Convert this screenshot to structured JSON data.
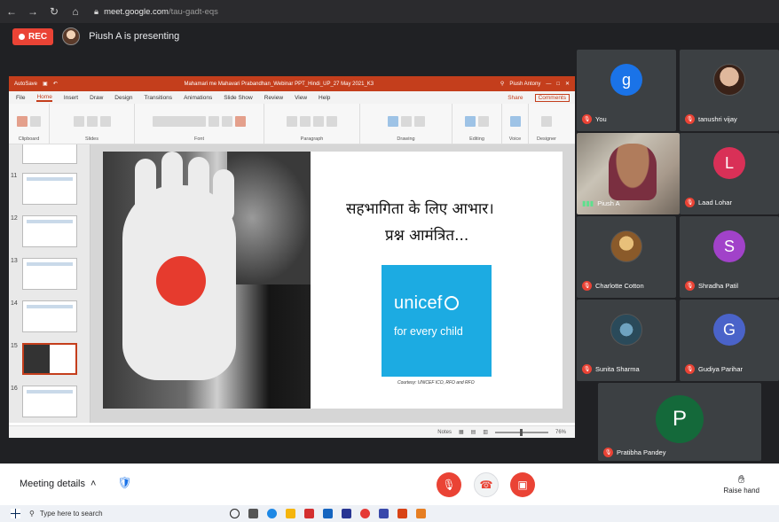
{
  "browser": {
    "url_host": "meet.google.com",
    "url_path": "/tau-gadt-eqs"
  },
  "meet": {
    "rec_label": "REC",
    "presenting_text": "Piush A is presenting",
    "meeting_details_label": "Meeting details",
    "raise_hand_label": "Raise hand"
  },
  "ppt": {
    "autosave_label": "AutoSave",
    "document_title": "Mahamari me Mahavari Prabandhan_Webinar PPT_Hindi_UP_27 May 2021_K3",
    "user_name": "Piush Antony",
    "menu": [
      "File",
      "Home",
      "Insert",
      "Draw",
      "Design",
      "Transitions",
      "Animations",
      "Slide Show",
      "Review",
      "View",
      "Help"
    ],
    "share_label": "Share",
    "comments_label": "Comments",
    "ribbon_groups": [
      "Clipboard",
      "Slides",
      "Font",
      "Paragraph",
      "Drawing",
      "Editing",
      "Voice",
      "Designer"
    ],
    "thumb_numbers": [
      "11",
      "12",
      "13",
      "14",
      "15",
      "16"
    ],
    "selected_thumb": "15",
    "status_notes": "Notes",
    "zoom_level": "76%"
  },
  "slide": {
    "line1": "सहभागिता के लिए आभार।",
    "line2": "प्रश्न आमंत्रित...",
    "unicef_logo": "unicef",
    "unicef_tagline": "for every child",
    "courtesy": "Courtesy: UNICEF ICO, RFO and RFO"
  },
  "participants": [
    {
      "name": "You",
      "initial": "g",
      "color": "#1a73e8"
    },
    {
      "name": "tanushri vijay",
      "initial": "",
      "color": "#7a4a3a"
    },
    {
      "name": "Piush A",
      "initial": "",
      "color": ""
    },
    {
      "name": "Laad Lohar",
      "initial": "L",
      "color": "#d93057"
    },
    {
      "name": "Charlotte Cotton",
      "initial": "",
      "color": "#c9884a"
    },
    {
      "name": "Shradha Patil",
      "initial": "S",
      "color": "#a142c9"
    },
    {
      "name": "Sunita Sharma",
      "initial": "",
      "color": "#3a6f8a"
    },
    {
      "name": "Gudiya Parihar",
      "initial": "G",
      "color": "#4a63c9"
    },
    {
      "name": "Pratibha Pandey",
      "initial": "P",
      "color": "#14693a"
    }
  ],
  "taskbar": {
    "search_placeholder": "Type here to search"
  }
}
